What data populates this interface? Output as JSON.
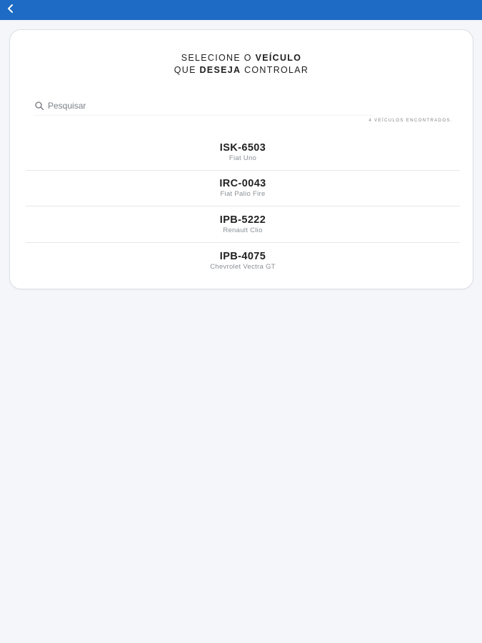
{
  "header": {
    "back_icon": "chevron-left-icon",
    "color": "#1d6bc4"
  },
  "card": {
    "title_line1_prefix": "SELECIONE O ",
    "title_line1_bold": "VEÍCULO",
    "title_line2_prefix": "QUE ",
    "title_line2_bold": "DESEJA",
    "title_line2_suffix": " CONTROLAR"
  },
  "search": {
    "placeholder": "Pesquisar",
    "icon": "search-icon"
  },
  "count_label": "4 veículos encontrados.",
  "vehicles": [
    {
      "plate": "ISK-6503",
      "model": "Fiat Uno"
    },
    {
      "plate": "IRC-0043",
      "model": "Fiat Palio Fire"
    },
    {
      "plate": "IPB-5222",
      "model": "Renault Clio"
    },
    {
      "plate": "IPB-4075",
      "model": "Chevrolet Vectra GT"
    }
  ]
}
